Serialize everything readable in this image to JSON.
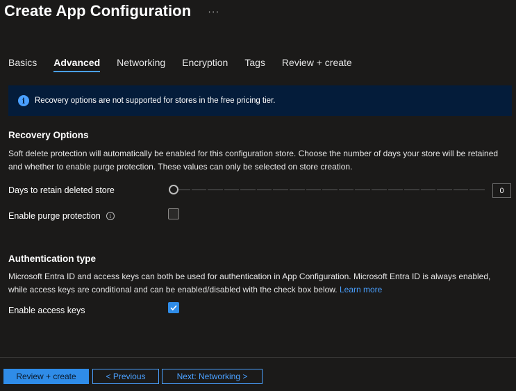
{
  "header": {
    "title": "Create App Configuration",
    "more_label": "···"
  },
  "tabs": [
    {
      "label": "Basics",
      "active": false
    },
    {
      "label": "Advanced",
      "active": true
    },
    {
      "label": "Networking",
      "active": false
    },
    {
      "label": "Encryption",
      "active": false
    },
    {
      "label": "Tags",
      "active": false
    },
    {
      "label": "Review + create",
      "active": false
    }
  ],
  "info_banner": {
    "icon": "info-icon",
    "text": "Recovery options are not supported for stores in the free pricing tier."
  },
  "recovery": {
    "heading": "Recovery Options",
    "description": "Soft delete protection will automatically be enabled for this configuration store. Choose the number of days your store will be retained and whether to enable purge protection. These values can only be selected on store creation.",
    "days_label": "Days to retain deleted store",
    "days_value": "0",
    "purge_label": "Enable purge protection",
    "purge_checked": false
  },
  "authentication": {
    "heading": "Authentication type",
    "description": "Microsoft Entra ID and access keys can both be used for authentication in App Configuration. Microsoft Entra ID is always enabled, while access keys are conditional and can be enabled/disabled with the check box below.",
    "learn_more": "Learn more",
    "access_keys_label": "Enable access keys",
    "access_keys_checked": true
  },
  "footer": {
    "review_label": "Review + create",
    "previous_label": "< Previous",
    "next_label": "Next: Networking >"
  },
  "colors": {
    "background": "#1b1a19",
    "accent": "#2f8ce8",
    "link": "#4aa0ff",
    "info_banner_bg": "#041c3a"
  }
}
